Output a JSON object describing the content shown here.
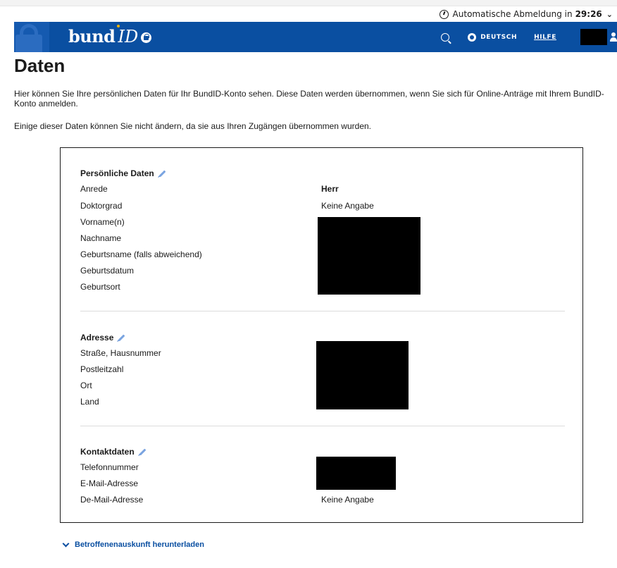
{
  "session": {
    "label": "Automatische Abmeldung in",
    "time": "29:26"
  },
  "header": {
    "brand_bund": "bund",
    "brand_id": "ID",
    "language": "DEUTSCH",
    "help": "HILFE"
  },
  "page": {
    "title": "Daten",
    "intro": "Hier können Sie Ihre persönlichen Daten für Ihr BundID-Konto sehen. Diese Daten werden übernommen, wenn Sie sich für Online-Anträge mit Ihrem BundID-Konto anmelden.",
    "intro2": "Einige dieser Daten können Sie nicht ändern, da sie aus Ihren Zugängen übernommen wurden."
  },
  "personal": {
    "title": "Persönliche Daten",
    "labels": [
      "Anrede",
      "Doktorgrad",
      "Vorname(n)",
      "Nachname",
      "Geburtsname (falls abweichend)",
      "Geburtsdatum",
      "Geburtsort"
    ],
    "anrede_value": "Herr",
    "doktorgrad_value": "Keine Angabe"
  },
  "address": {
    "title": "Adresse",
    "labels": [
      "Straße, Hausnummer",
      "Postleitzahl",
      "Ort",
      "Land"
    ]
  },
  "contact": {
    "title": "Kontaktdaten",
    "labels": [
      "Telefonnummer",
      "E-Mail-Adresse",
      "De-Mail-Adresse"
    ],
    "demail_value": "Keine Angabe"
  },
  "download": {
    "label": "Betroffenenauskunft herunterladen"
  },
  "colors": {
    "brand_blue": "#0a4fa1",
    "link_blue": "#0a4fa1"
  }
}
